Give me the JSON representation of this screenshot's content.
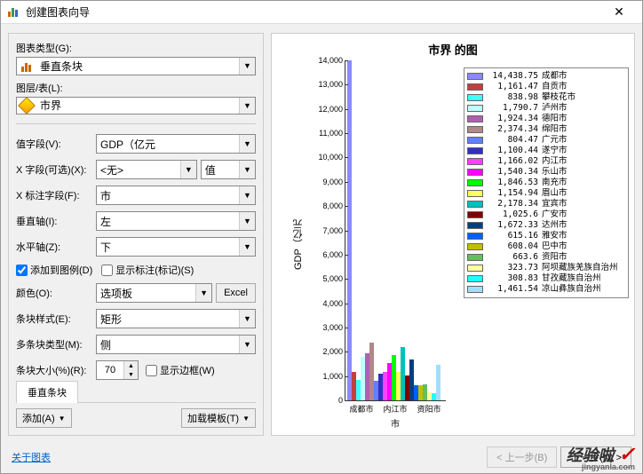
{
  "window": {
    "title": "创建图表向导"
  },
  "left": {
    "chart_type_label": "图表类型(G):",
    "chart_type_value": "垂直条块",
    "layer_label": "图层/表(L):",
    "layer_value": "市界",
    "rows": {
      "value_field": {
        "label": "值字段(V):",
        "value": "GDP（亿元"
      },
      "x_field": {
        "label": "X 字段(可选)(X):",
        "value": "<无>",
        "mode": "值"
      },
      "x_label_field": {
        "label": "X 标注字段(F):",
        "value": "市"
      },
      "vertical_axis": {
        "label": "垂直轴(I):",
        "value": "左"
      },
      "horizontal_axis": {
        "label": "水平轴(Z):",
        "value": "下"
      }
    },
    "add_legend": "添加到图例(D)",
    "show_labels": "显示标注(标记)(S)",
    "color_label": "颜色(O):",
    "color_value": "选项板",
    "excel_btn": "Excel",
    "bar_style": {
      "label": "条块样式(E):",
      "value": "矩形"
    },
    "multi_bar": {
      "label": "多条块类型(M):",
      "value": "侧"
    },
    "bar_size": {
      "label": "条块大小(%)(R):",
      "value": "70"
    },
    "show_border": "显示边框(W)",
    "tab": "垂直条块",
    "add_btn": "添加(A)",
    "load_tpl_btn": "加载模板(T)"
  },
  "chart_data": {
    "type": "bar",
    "title": "市界  的图",
    "ylabel": "GDP（亿元",
    "xlabel": "市",
    "ylim": [
      0,
      14000
    ],
    "yticks": [
      0,
      1000,
      2000,
      3000,
      4000,
      5000,
      6000,
      7000,
      8000,
      9000,
      10000,
      11000,
      12000,
      13000,
      14000
    ],
    "xticks": [
      "成都市",
      "内江市",
      "资阳市"
    ],
    "series": [
      {
        "name": "成都市",
        "value": 14438.75,
        "color": "#8a8aff"
      },
      {
        "name": "自贡市",
        "value": 1161.47,
        "color": "#c04040"
      },
      {
        "name": "攀枝花市",
        "value": 838.98,
        "color": "#40ffff"
      },
      {
        "name": "泸州市",
        "value": 1790.7,
        "color": "#c0ffff"
      },
      {
        "name": "德阳市",
        "value": 1924.34,
        "color": "#b060b0"
      },
      {
        "name": "绵阳市",
        "value": 2374.34,
        "color": "#b08888"
      },
      {
        "name": "广元市",
        "value": 804.47,
        "color": "#6080ff"
      },
      {
        "name": "遂宁市",
        "value": 1100.44,
        "color": "#3030c0"
      },
      {
        "name": "内江市",
        "value": 1166.02,
        "color": "#ff40ff"
      },
      {
        "name": "乐山市",
        "value": 1540.34,
        "color": "#ff00ff"
      },
      {
        "name": "南充市",
        "value": 1846.53,
        "color": "#00ff00"
      },
      {
        "name": "眉山市",
        "value": 1154.94,
        "color": "#ffff60"
      },
      {
        "name": "宜宾市",
        "value": 2178.34,
        "color": "#00c0c0"
      },
      {
        "name": "广安市",
        "value": 1025.6,
        "color": "#800000"
      },
      {
        "name": "达州市",
        "value": 1672.33,
        "color": "#004080"
      },
      {
        "name": "雅安市",
        "value": 615.16,
        "color": "#0060ff"
      },
      {
        "name": "巴中市",
        "value": 608.04,
        "color": "#c0c000"
      },
      {
        "name": "资阳市",
        "value": 663.6,
        "color": "#60c060"
      },
      {
        "name": "阿坝藏族羌族自治州",
        "value": 323.73,
        "color": "#ffffa0"
      },
      {
        "name": "甘孜藏族自治州",
        "value": 308.83,
        "color": "#20ffff"
      },
      {
        "name": "凉山彝族自治州",
        "value": 1461.54,
        "color": "#a0e0ff"
      }
    ]
  },
  "footer": {
    "about": "关于图表",
    "prev": "< 上一步(B)",
    "next": "下一步(N) >"
  },
  "watermark": {
    "text": "经验啦",
    "sub": "jingyanla.com"
  }
}
